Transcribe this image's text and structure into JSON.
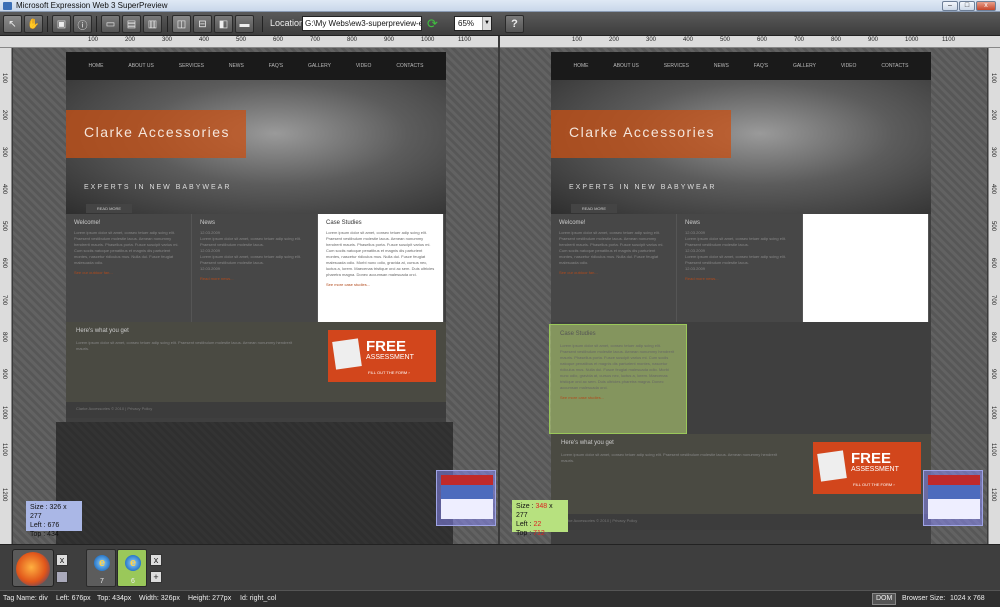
{
  "window": {
    "title": "Microsoft Expression Web 3 SuperPreview",
    "minimize": "–",
    "maximize": "□",
    "close": "x"
  },
  "toolbar": {
    "location_label": "Location:",
    "location_value": "G:\\My Webs\\ew3-superpreview-exar",
    "zoom_value": "65%",
    "help": "?"
  },
  "ruler": {
    "h_left": [
      "100",
      "200",
      "300",
      "400",
      "500",
      "600",
      "700",
      "800",
      "900",
      "1000",
      "1100"
    ],
    "h_right": [
      "100",
      "200",
      "300",
      "400",
      "500",
      "600",
      "700",
      "800",
      "900",
      "1000",
      "1100"
    ],
    "v_left": [
      "100",
      "200",
      "300",
      "400",
      "500",
      "600",
      "700",
      "800",
      "900",
      "1000",
      "1100",
      "1200"
    ],
    "v_right": [
      "100",
      "200",
      "300",
      "400",
      "500",
      "600",
      "700",
      "800",
      "900",
      "1000",
      "1100",
      "1200"
    ]
  },
  "site": {
    "nav": [
      "HOME",
      "ABOUT US",
      "SERVICES",
      "NEWS",
      "FAQ'S",
      "GALLERY",
      "VIDEO",
      "CONTACTS"
    ],
    "brand": "Clarke Accessories",
    "expert": "EXPERTS IN NEW BABYWEAR",
    "read_more": "READ MORE",
    "welcome_title": "Welcome!",
    "welcome_text": "Lorem ipsum dolor sit amet, consec tetuer adip scing elit. Praesent vestibulum molestie lacus. Aenean nonummy hendrerit mauris. Phasellus porta. Fusce suscipit varius mi. Cum sociis natoque penatibus et magnis dis parturient montes, nascetur ridiculus mus. Nulla dui. Fusce feugiat malesuada odio.",
    "welcome_link": "See our outdoor fan...",
    "news_title": "News",
    "news_dates": [
      "12.03.2009",
      "12.03.2009",
      "12.03.2009"
    ],
    "news_text": "Lorem ipsum dolor sit amet, consec tetuer adip scing elit. Praesent vestibulum molestie lacus.",
    "news_more": "more...",
    "news_link": "Read more news...",
    "case_title": "Case Studies",
    "case_text": "Lorem ipsum dolor sit amet, consec tetuer adip scing elit. Praesent vestibulum molestie lacus. Aenean nonummy hendrerit mauris. Phasellus porta. Fusce suscipit varius mi. Cum sociis natoque penatibus et magnis dis parturient montes, nascetur ridiculus mus. Nulla dui. Fusce feugiat malesuada odio. Morbi nunc odio, gravida at, cursus nec, luctus a, lorem. Maecenas tristique orci ac sem. Duis ultricies pharetra magna. Donec accumsan malesuada orci.",
    "case_link": "See more case studies...",
    "here_title": "Here's what you get",
    "here_text": "Lorem ipsum dolor sit amet, consec tetuer adip scing elit. Praesent vestibulum molestie lacus. Aenean nonummy hendrerit mauris.",
    "here_link": "Read more benefits...",
    "free": "FREE",
    "assessment": "ASSESSMENT",
    "fill_out": "FILL OUT THE FORM ›",
    "footer": "Clarke Accessories © 2010 | Privacy Policy"
  },
  "info_left": {
    "size_label": "Size :",
    "size": "326 x 277",
    "left_label": "Left :",
    "left": "676",
    "top_label": "Top :",
    "top": "434"
  },
  "info_right": {
    "size_label": "Size :",
    "size_w": "348",
    "size_sep": " x ",
    "size_h": "277",
    "left_label": "Left :",
    "left": "22",
    "top_label": "Top :",
    "top": "712"
  },
  "browsers": {
    "ie_left_num": "7",
    "ie_right_num": "6",
    "add": "+",
    "remove": "x"
  },
  "status": {
    "tag": "Tag Name: div",
    "left": "Left: 676px",
    "top": "Top: 434px",
    "width": "Width: 326px",
    "height": "Height: 277px",
    "id": "Id: right_col",
    "dom": "DOM",
    "browser_size_label": "Browser Size:",
    "browser_size": "1024 x 768"
  }
}
